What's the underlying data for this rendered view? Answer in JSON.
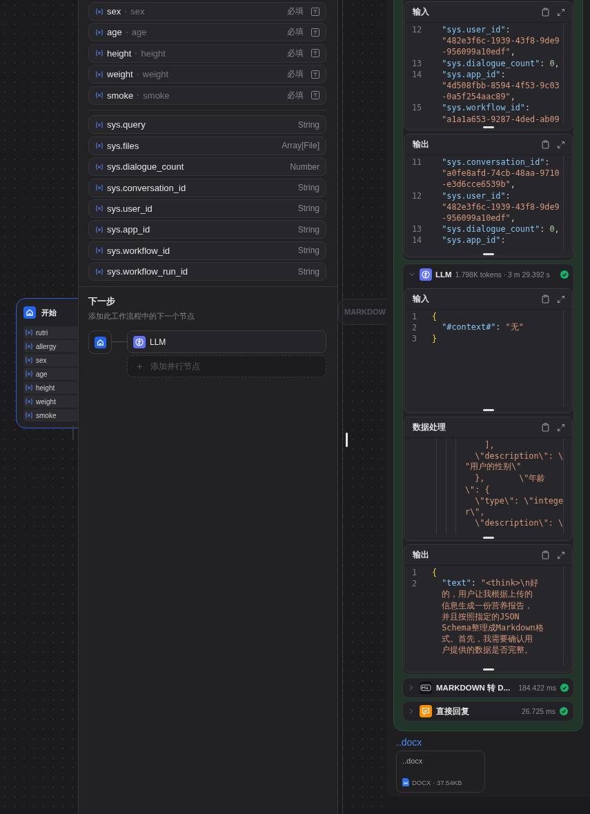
{
  "canvas": {
    "start_node": {
      "title": "开始",
      "vars": [
        "rutri",
        "allergy",
        "sex",
        "age",
        "height",
        "weight",
        "smoke"
      ]
    },
    "faded_node": {
      "title": "MARKDOW"
    }
  },
  "node_panel": {
    "input_vars": [
      {
        "name": "sex",
        "label": "sex",
        "tag": "必填"
      },
      {
        "name": "age",
        "label": "age",
        "tag": "必填"
      },
      {
        "name": "height",
        "label": "height",
        "tag": "必填"
      },
      {
        "name": "weight",
        "label": "weight",
        "tag": "必填"
      },
      {
        "name": "smoke",
        "label": "smoke",
        "tag": "必填"
      }
    ],
    "system_vars": [
      {
        "name": "sys.query",
        "type": "String"
      },
      {
        "name": "sys.files",
        "type": "Array[File]"
      },
      {
        "name": "sys.dialogue_count",
        "type": "Number"
      },
      {
        "name": "sys.conversation_id",
        "type": "String"
      },
      {
        "name": "sys.user_id",
        "type": "String"
      },
      {
        "name": "sys.app_id",
        "type": "String"
      },
      {
        "name": "sys.workflow_id",
        "type": "String"
      },
      {
        "name": "sys.workflow_run_id",
        "type": "String"
      }
    ],
    "next_step": {
      "title": "下一步",
      "subtitle": "添加此工作流程中的下一个节点",
      "node": "LLM",
      "add_parallel": "添加并行节点"
    }
  },
  "run_panel": {
    "prev_blocks": [
      {
        "title": "输入",
        "kind": "plain",
        "rows": [
          {
            "num": "12",
            "parts": [
              {
                "kind": "key",
                "text": "  \"sys.user_id\""
              },
              {
                "kind": "punct",
                "text": ":"
              }
            ]
          },
          {
            "parts": [
              {
                "kind": "str",
                "text": "  \"482e3f6c-1939-43f8-9de9"
              }
            ]
          },
          {
            "parts": [
              {
                "kind": "str",
                "text": "  -956099a10edf\""
              },
              {
                "kind": "punct",
                "text": ","
              }
            ]
          },
          {
            "num": "13",
            "parts": [
              {
                "kind": "key",
                "text": "  \"sys.dialogue_count\""
              },
              {
                "kind": "punct",
                "text": ": "
              },
              {
                "kind": "num",
                "text": "0"
              },
              {
                "kind": "punct",
                "text": ","
              }
            ]
          },
          {
            "num": "14",
            "parts": [
              {
                "kind": "key",
                "text": "  \"sys.app_id\""
              },
              {
                "kind": "punct",
                "text": ":"
              }
            ]
          },
          {
            "parts": [
              {
                "kind": "str",
                "text": "  \"4d508fbb-8594-4f53-9c03"
              }
            ]
          },
          {
            "parts": [
              {
                "kind": "str",
                "text": "  -0a5f254aac89\""
              },
              {
                "kind": "punct",
                "text": ","
              }
            ]
          },
          {
            "num": "15",
            "parts": [
              {
                "kind": "key",
                "text": "  \"sys.workflow_id\""
              },
              {
                "kind": "punct",
                "text": ":"
              }
            ]
          },
          {
            "parts": [
              {
                "kind": "str",
                "text": "  \"a1a1a653-9287-4ded-ab09"
              }
            ]
          }
        ]
      },
      {
        "title": "输出",
        "kind": "plain",
        "rows": [
          {
            "num": "11",
            "parts": [
              {
                "kind": "key",
                "text": "  \"sys.conversation_id\""
              },
              {
                "kind": "punct",
                "text": ":"
              }
            ]
          },
          {
            "parts": [
              {
                "kind": "str",
                "text": "  \"a0fe8afd-74cb-48aa-9710"
              }
            ]
          },
          {
            "parts": [
              {
                "kind": "str",
                "text": "  -e3d6cce6539b\""
              },
              {
                "kind": "punct",
                "text": ","
              }
            ]
          },
          {
            "num": "12",
            "parts": [
              {
                "kind": "key",
                "text": "  \"sys.user_id\""
              },
              {
                "kind": "punct",
                "text": ":"
              }
            ]
          },
          {
            "parts": [
              {
                "kind": "str",
                "text": "  \"482e3f6c-1939-43f8-9de9"
              }
            ]
          },
          {
            "parts": [
              {
                "kind": "str",
                "text": "  -956099a10edf\""
              },
              {
                "kind": "punct",
                "text": ","
              }
            ]
          },
          {
            "num": "13",
            "parts": [
              {
                "kind": "key",
                "text": "  \"sys.dialogue_count\""
              },
              {
                "kind": "punct",
                "text": ": "
              },
              {
                "kind": "num",
                "text": "0"
              },
              {
                "kind": "punct",
                "text": ","
              }
            ]
          },
          {
            "num": "14",
            "parts": [
              {
                "kind": "key",
                "text": "  \"sys.app_id\""
              },
              {
                "kind": "punct",
                "text": ":"
              }
            ]
          }
        ]
      }
    ],
    "llm": {
      "title": "LLM",
      "meta": "1.798K tokens · 3 m 29.392 s",
      "expanded": true,
      "blocks": [
        {
          "title": "输入",
          "kind": "plain",
          "rows": [
            {
              "num": "1",
              "parts": [
                {
                  "kind": "brace",
                  "text": "{"
                }
              ]
            },
            {
              "num": "2",
              "parts": [
                {
                  "kind": "key",
                  "text": "  \"#context#\""
                },
                {
                  "kind": "punct",
                  "text": ": "
                },
                {
                  "kind": "str",
                  "text": "\"无\""
                }
              ]
            },
            {
              "num": "3",
              "parts": [
                {
                  "kind": "brace",
                  "text": "}"
                }
              ]
            }
          ]
        },
        {
          "title": "数据处理",
          "kind": "nested",
          "rows": [
            {
              "parts": [
                {
                  "kind": "str",
                  "text": "    ],"
                }
              ]
            },
            {
              "parts": [
                {
                  "kind": "str",
                  "text": "  \\\"description\\\": \\"
                }
              ]
            },
            {
              "parts": [
                {
                  "kind": "str",
                  "text": "\"用户的性别\\\""
                }
              ]
            },
            {
              "parts": [
                {
                  "kind": "str",
                  "text": "  },       \\\"年龄"
                }
              ]
            },
            {
              "parts": [
                {
                  "kind": "str",
                  "text": "\\\": {"
                }
              ]
            },
            {
              "parts": [
                {
                  "kind": "str",
                  "text": "  \\\"type\\\": \\\"intege"
                }
              ]
            },
            {
              "parts": [
                {
                  "kind": "str",
                  "text": "r\\\","
                }
              ]
            },
            {
              "parts": [
                {
                  "kind": "str",
                  "text": "  \\\"description\\\": \\"
                }
              ]
            }
          ]
        },
        {
          "title": "输出",
          "kind": "plain",
          "rows": [
            {
              "num": "1",
              "parts": [
                {
                  "kind": "brace",
                  "text": "{"
                }
              ]
            },
            {
              "num": "2",
              "parts": [
                {
                  "kind": "key",
                  "text": "  \"text\""
                },
                {
                  "kind": "punct",
                  "text": ": "
                },
                {
                  "kind": "str",
                  "text": "\"<think>\\n好"
                }
              ]
            },
            {
              "parts": [
                {
                  "kind": "str",
                  "text": "  的，用户让我根据上传的"
                }
              ]
            },
            {
              "parts": [
                {
                  "kind": "str",
                  "text": "  信息生成一份营养报告，"
                }
              ]
            },
            {
              "parts": [
                {
                  "kind": "str",
                  "text": "  并且按照指定的JSON"
                }
              ]
            },
            {
              "parts": [
                {
                  "kind": "str",
                  "text": "  Schema整理成Markdown格"
                }
              ]
            },
            {
              "parts": [
                {
                  "kind": "str",
                  "text": "  式。首先，我需要确认用"
                }
              ]
            },
            {
              "parts": [
                {
                  "kind": "str",
                  "text": "  户提供的数据是否完整。"
                }
              ]
            }
          ]
        }
      ]
    },
    "steps": [
      {
        "kind": "markdown",
        "title": "MARKDOWN 转 D...",
        "time": "184.422 ms",
        "expanded": false
      },
      {
        "kind": "answer",
        "title": "直接回复",
        "time": "26.725 ms",
        "expanded": false
      }
    ],
    "file_link": "..docx",
    "file": {
      "name": "..docx",
      "meta": "DOCX · 37.54KB"
    }
  }
}
